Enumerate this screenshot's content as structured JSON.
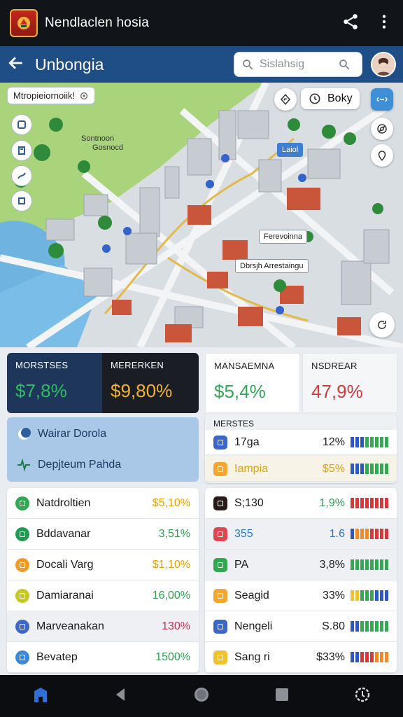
{
  "app": {
    "title": "Nendlaclen hosia",
    "logo_icon": "emblem-icon",
    "share_icon": "share-icon",
    "menu_icon": "more-vert-icon"
  },
  "header": {
    "title": "Unbongia",
    "search_placeholder": "Sislahsig"
  },
  "map": {
    "location_label": "Mtropieiornoiik!",
    "area_label_line1": "Sontnoon",
    "area_label_line2": "Gosnocd",
    "pill_label": "Boky",
    "note1": "Ferevoinna",
    "note2": "Dbrsjh Arrestaingu",
    "tag": "Laiol"
  },
  "metrics": [
    {
      "label": "MORSTSES",
      "value": "$7,8%",
      "bg": "#1d3659",
      "label_color": "#ffffff",
      "value_color": "#2fbd63"
    },
    {
      "label": "MERERKEN",
      "value": "$9,80%",
      "bg": "#1a1d24",
      "label_color": "#ffffff",
      "value_color": "#f5b323"
    },
    {
      "label": "MANSAEMNA",
      "value": "$5,4%",
      "bg": "#ffffff",
      "label_color": "#222222",
      "value_color": "#2fa85a"
    },
    {
      "label": "NSDREAR",
      "value": "47,9%",
      "bg": "#f4f6f8",
      "label_color": "#222222",
      "value_color": "#d23a3e"
    }
  ],
  "blue_panel": {
    "row1": "Wairar Dorola",
    "row2": "Depjteum Pahda"
  },
  "right_top": {
    "title": "MERSTES",
    "rows": [
      {
        "name": "17ga",
        "value": "12%",
        "icon_color": "#3c66c8",
        "value_color": "#222",
        "bars": [
          "#2d57c2",
          "#2d57c2",
          "#2d57c2",
          "#34a853",
          "#34a853",
          "#34a853",
          "#34a853",
          "#34a853"
        ]
      },
      {
        "name": "Iampia",
        "value": "$5%",
        "icon_color": "#f3a72e",
        "value_color": "#e5a100",
        "bars": [
          "#2d57c2",
          "#2d57c2",
          "#2d57c2",
          "#34a853",
          "#34a853",
          "#34a853",
          "#34a853",
          "#34a853"
        ],
        "name_color": "#e5a100"
      }
    ]
  },
  "left_list": [
    {
      "name": "Natdroltien",
      "value": "$5,10%",
      "icon_color": "#2fa84f",
      "value_color": "#e5a100"
    },
    {
      "name": "Bddavanar",
      "value": "3,51%",
      "icon_color": "#1e9b4e",
      "value_color": "#2f9e4f"
    },
    {
      "name": "Docali Varg",
      "value": "$1,10%",
      "icon_color": "#f39a2a",
      "value_color": "#e5a100"
    },
    {
      "name": "Damiaranai",
      "value": "16,00%",
      "icon_color": "#c6c728",
      "value_color": "#2f9e4f"
    },
    {
      "name": "Marveanakan",
      "value": "130%",
      "icon_color": "#3c66c8",
      "value_color": "#c23254"
    },
    {
      "name": "Bevatep",
      "value": "1500%",
      "icon_color": "#3c88d8",
      "value_color": "#2f9e4f"
    }
  ],
  "right_list": [
    {
      "name": "S;130",
      "value": "1,9%",
      "icon_color": "#2a1b1b",
      "value_color": "#2f9e4f",
      "bars": [
        "#d43a3a",
        "#d43a3a",
        "#d43a3a",
        "#d43a3a",
        "#d43a3a",
        "#d43a3a",
        "#d43a3a",
        "#d43a3a"
      ]
    },
    {
      "name": "355",
      "value": "1.6",
      "icon_color": "#e0464f",
      "value_color": "#2d74c6",
      "name_color": "#2d74c6",
      "bars": [
        "#2d57c2",
        "#f08a2a",
        "#f08a2a",
        "#f08a2a",
        "#d43a3a",
        "#d43a3a",
        "#d43a3a",
        "#d43a3a"
      ]
    },
    {
      "name": "PA",
      "value": "3,8%",
      "icon_color": "#2fa84f",
      "value_color": "#222",
      "bars": [
        "#34a853",
        "#34a853",
        "#34a853",
        "#34a853",
        "#34a853",
        "#34a853",
        "#34a853",
        "#34a853"
      ]
    },
    {
      "name": "Seagid",
      "value": "33%",
      "icon_color": "#f3a72e",
      "value_color": "#222",
      "bars": [
        "#f2c22b",
        "#f2c22b",
        "#34a853",
        "#34a853",
        "#34a853",
        "#2d57c2",
        "#2d57c2",
        "#2d57c2"
      ]
    },
    {
      "name": "Nengeli",
      "value": "S.80",
      "icon_color": "#3c66c8",
      "value_color": "#222",
      "bars": [
        "#2d57c2",
        "#2d57c2",
        "#34a853",
        "#34a853",
        "#34a853",
        "#34a853",
        "#34a853",
        "#34a853"
      ]
    },
    {
      "name": "Sang ri",
      "value": "$33%",
      "icon_color": "#f2c22b",
      "value_color": "#222",
      "bars": [
        "#2d57c2",
        "#2d57c2",
        "#d43a3a",
        "#d43a3a",
        "#d43a3a",
        "#f08a2a",
        "#f08a2a",
        "#f08a2a"
      ]
    }
  ]
}
